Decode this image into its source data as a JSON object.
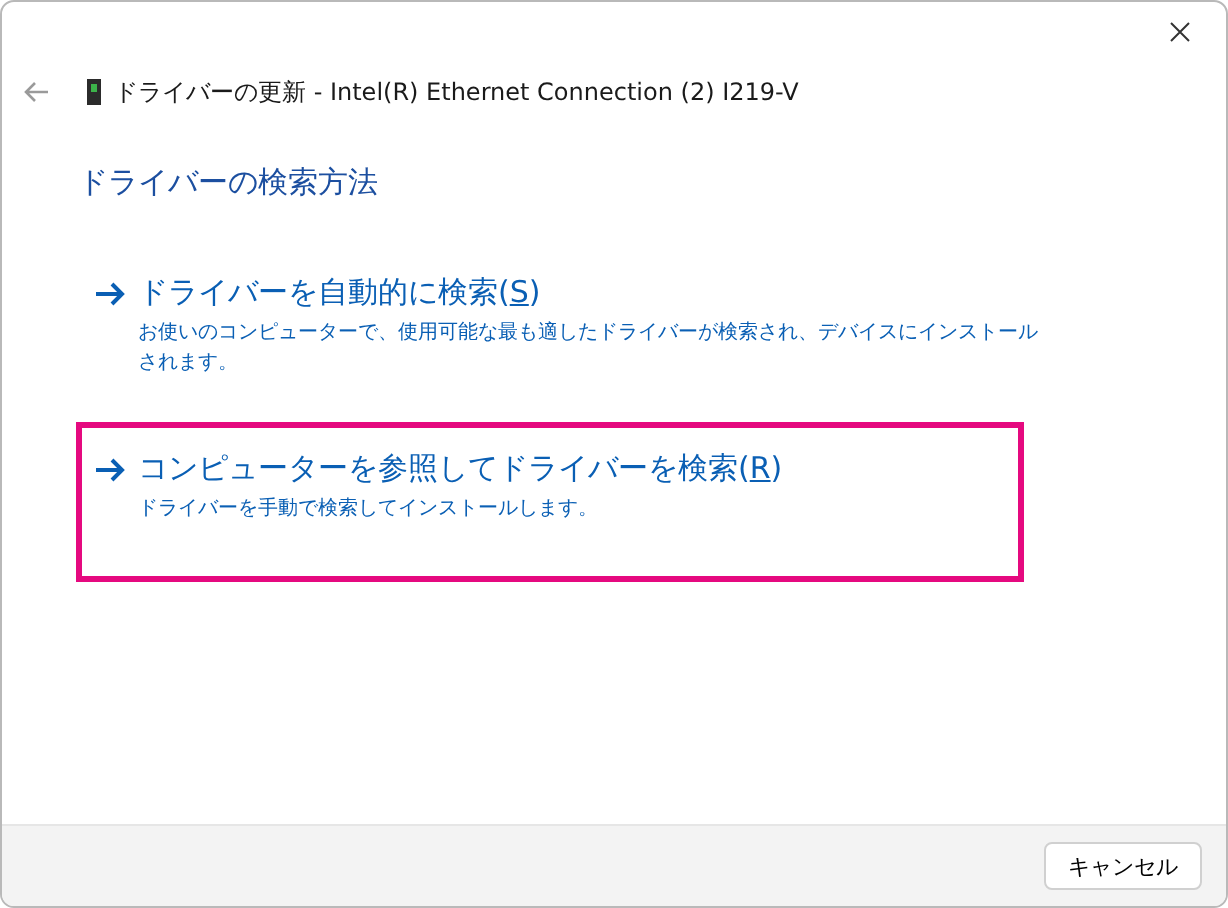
{
  "window": {
    "title": "ドライバーの更新 - Intel(R) Ethernet Connection (2) I219-V"
  },
  "heading": "ドライバーの検索方法",
  "options": [
    {
      "label": "ドライバーを自動的に検索(",
      "access_key": "S",
      "label_end": ")",
      "description": "お使いのコンピューターで、使用可能な最も適したドライバーが検索され、デバイスにインストールされます。",
      "highlighted": false
    },
    {
      "label": "コンピューターを参照してドライバーを検索(",
      "access_key": "R",
      "label_end": ")",
      "description": "ドライバーを手動で検索してインストールします。",
      "highlighted": true
    }
  ],
  "buttons": [
    {
      "label": "キャンセル"
    }
  ]
}
